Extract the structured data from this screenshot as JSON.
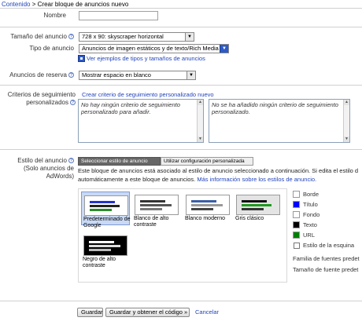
{
  "breadcrumb": {
    "link": "Contenido",
    "separator": ">",
    "current": "Crear bloque de anuncios nuevo"
  },
  "form": {
    "name_label": "Nombre",
    "name_value": "",
    "size_label": "Tamaño del anuncio",
    "size_value": "728 x 90: skyscraper horizontal",
    "type_label": "Tipo de anuncio",
    "type_value": "Anuncios de imagen estáticos y de texto/Rich Media",
    "examples_link": "Ver ejemplos de tipos y tamaños de anuncios",
    "backup_label": "Anuncios de reserva",
    "backup_value": "Mostrar espacio en blanco",
    "tracking_label_1": "Criterios de seguimiento",
    "tracking_label_2": "personalizados",
    "tracking_create_link": "Crear criterio de seguimiento personalizado nuevo",
    "tracking_left_text": "No hay ningún criterio de seguimiento personalizado para añadir.",
    "tracking_right_text": "No se ha añadido ningún criterio de seguimiento personalizado."
  },
  "style": {
    "label_1": "Estilo del anuncio",
    "label_2": "(Solo anuncios de",
    "label_3": "AdWords)",
    "tab_active": "Seleccionar estilo de anuncio",
    "tab_inactive": "Utilizar configuración personalizada",
    "info_line1": "Este bloque de anuncios está asociado al estilo de anuncio seleccionado a continuación. Si edita el estilo d",
    "info_line2_a": "automáticamente a este bloque de anuncios.",
    "info_line2_link": "Más información sobre los estilos de anuncio.",
    "cards": [
      {
        "title": "Predeterminado de Google"
      },
      {
        "title": "Blanco de alto contraste"
      },
      {
        "title": "Blanco moderno"
      },
      {
        "title": "Gris clásico"
      },
      {
        "title": "Negro de alto contraste"
      }
    ],
    "swatches": [
      {
        "label": "Borde",
        "color": "#ffffff"
      },
      {
        "label": "Título",
        "color": "#0000ff"
      },
      {
        "label": "Fondo",
        "color": "#ffffff"
      },
      {
        "label": "Texto",
        "color": "#000000"
      },
      {
        "label": "URL",
        "color": "#008000"
      }
    ],
    "corner_label": "Estilo de la esquina",
    "font_family_label": "Familia de fuentes predet",
    "font_size_label": "Tamaño de fuente predet"
  },
  "actions": {
    "save": "Guardar",
    "save_get_code": "Guardar y obtener el código »",
    "cancel": "Cancelar"
  }
}
